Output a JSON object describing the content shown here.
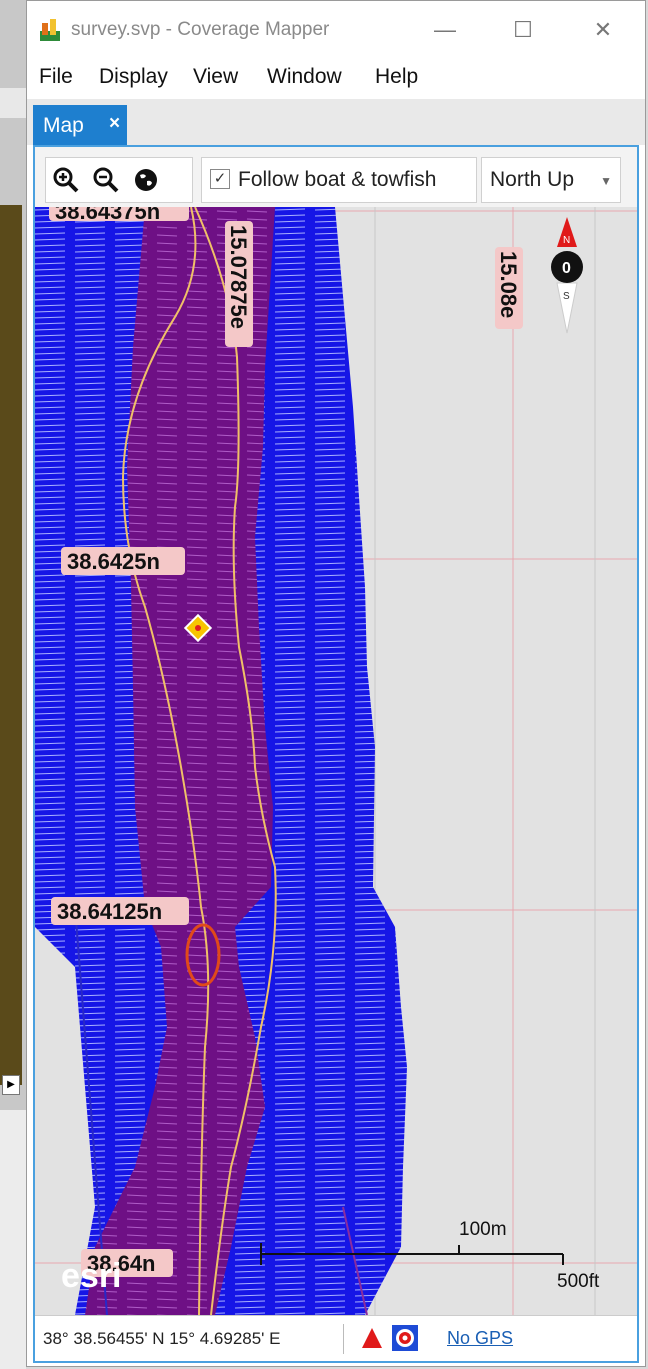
{
  "window": {
    "title": "survey.svp - Coverage Mapper",
    "controls": [
      "—",
      "☐",
      "✕"
    ]
  },
  "menu": [
    "File",
    "Display",
    "View",
    "Window",
    "Help"
  ],
  "tabs": [
    {
      "label": "Map",
      "close": "×"
    }
  ],
  "toolbar": {
    "follow_label": "Follow boat & towfish",
    "follow_checked": "✓",
    "orientation": "North Up"
  },
  "map": {
    "grid_labels": {
      "lat_top": "38.64375n",
      "lat_2": "38.6425n",
      "lat_3": "38.64125n",
      "lat_4": "38.64n",
      "lon_1": "15.07875e",
      "lon_2": "15.08e"
    },
    "compass": {
      "north": "N",
      "value": "0",
      "south": "S"
    },
    "scale_bar": {
      "metric": "100m",
      "imperial": "500ft"
    },
    "logo": "esri"
  },
  "status": {
    "coords": "38° 38.56455' N 15° 4.69285' E",
    "gps": "No GPS"
  },
  "colors": {
    "accent": "#1e7fcf",
    "coverage_blue": "#1616e6",
    "coverage_purple": "#6e1085",
    "track": "#f0c068"
  }
}
